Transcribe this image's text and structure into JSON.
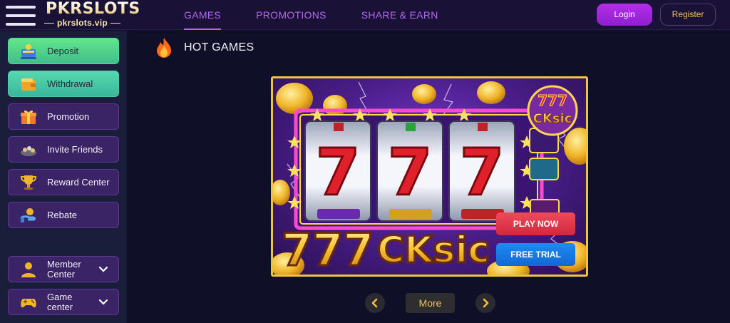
{
  "header": {
    "logo_text": "PKRSLOTS",
    "logo_subtext": "pkrslots.vip",
    "nav": [
      {
        "label": "GAMES",
        "active": true
      },
      {
        "label": "PROMOTIONS",
        "active": false
      },
      {
        "label": "SHARE & EARN",
        "active": false
      }
    ],
    "login_label": "Login",
    "register_label": "Register"
  },
  "sidebar": {
    "items": [
      {
        "label": "Deposit",
        "icon": "deposit-icon"
      },
      {
        "label": "Withdrawal",
        "icon": "wallet-icon"
      },
      {
        "label": "Promotion",
        "icon": "gift-icon"
      },
      {
        "label": "Invite Friends",
        "icon": "invite-friends-icon"
      },
      {
        "label": "Reward Center",
        "icon": "trophy-icon"
      },
      {
        "label": "Rebate",
        "icon": "rebate-icon"
      }
    ],
    "expandables": [
      {
        "label_line1": "Member",
        "label_line2": "Center",
        "icon": "member-icon"
      },
      {
        "label_line1": "Game",
        "label_line2": "center",
        "icon": "gamepad-icon"
      }
    ]
  },
  "main": {
    "section_title": "HOT GAMES",
    "game": {
      "name": "777 CKsic",
      "play_label": "PLAY NOW",
      "trial_label": "FREE TRIAL"
    },
    "more_label": "More"
  },
  "colors": {
    "accent": "#b166f0",
    "login_bg": "#a526dc",
    "register_text": "#f0c060",
    "play_now": "#e23a4e",
    "free_trial": "#1a7ce6",
    "card_border": "#f0c43a"
  }
}
